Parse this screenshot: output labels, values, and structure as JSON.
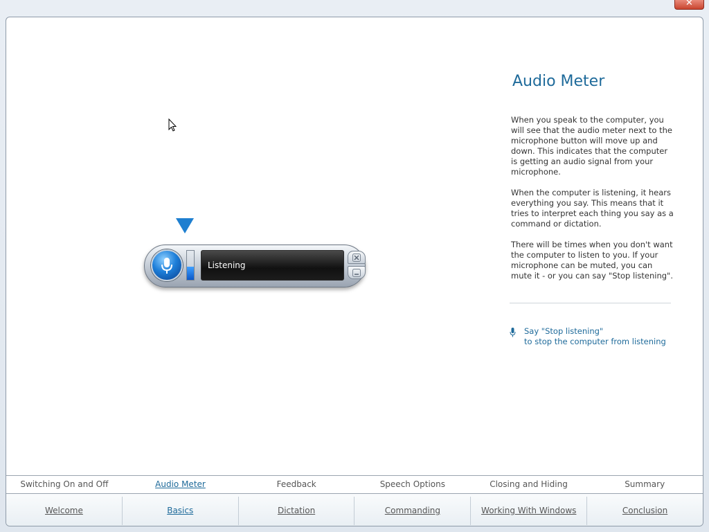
{
  "window": {
    "close_label": "✕"
  },
  "speech_widget": {
    "status_text": "Listening",
    "meter_level": 0.45
  },
  "panel": {
    "title": "Audio Meter",
    "paragraphs": [
      "When you speak to the computer, you will see that the audio meter next to the microphone button will move up and down. This indicates that the computer is getting an audio signal from your microphone.",
      "When the computer is listening, it hears everything you say. This means that it tries to interpret each thing you say as a command or dictation.",
      "There will be times when you don't want the computer to listen to you. If your microphone can be muted, you can mute it - or you can say \"Stop listening\"."
    ],
    "tip_line1": "Say \"Stop listening\"",
    "tip_line2": "to stop the computer from listening"
  },
  "subnav": {
    "items": [
      {
        "label": "Switching On and Off"
      },
      {
        "label": "Audio Meter"
      },
      {
        "label": "Feedback"
      },
      {
        "label": "Speech Options"
      },
      {
        "label": "Closing and Hiding"
      },
      {
        "label": "Summary"
      }
    ],
    "active_index": 1
  },
  "mainnav": {
    "items": [
      {
        "label": "Welcome"
      },
      {
        "label": "Basics"
      },
      {
        "label": "Dictation"
      },
      {
        "label": "Commanding"
      },
      {
        "label": "Working With Windows"
      },
      {
        "label": "Conclusion"
      }
    ],
    "active_index": 1
  },
  "colors": {
    "accent": "#1e6a9a",
    "pointer": "#1e7fd0"
  }
}
